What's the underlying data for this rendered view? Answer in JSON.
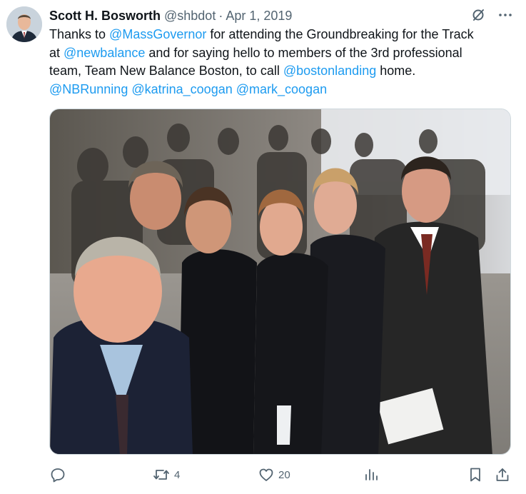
{
  "tweet": {
    "author_name": "Scott H. Bosworth",
    "author_handle": "@shbdot",
    "separator": "·",
    "date": "Apr 1, 2019",
    "text_lines": [
      [
        {
          "t": "Thanks to ",
          "m": false
        },
        {
          "t": "@MassGovernor",
          "m": true
        },
        {
          "t": " for attending the Groundbreaking for the Track",
          "m": false
        }
      ],
      [
        {
          "t": "at ",
          "m": false
        },
        {
          "t": "@newbalance",
          "m": true
        },
        {
          "t": " and for saying hello to members of the 3rd professional",
          "m": false
        }
      ],
      [
        {
          "t": "team, Team New Balance Boston, to call ",
          "m": false
        },
        {
          "t": "@bostonlanding",
          "m": true
        },
        {
          "t": " home.",
          "m": false
        }
      ],
      [
        {
          "t": "@NBRunning",
          "m": true
        },
        {
          "t": " ",
          "m": false
        },
        {
          "t": "@katrina_coogan",
          "m": true
        },
        {
          "t": " ",
          "m": false
        },
        {
          "t": "@mark_coogan",
          "m": true
        }
      ]
    ]
  },
  "actions": {
    "reply_count": "",
    "retweet_count": "4",
    "like_count": "20",
    "views_count": ""
  },
  "colors": {
    "accent": "#1d9bf0",
    "secondary_text": "#536471",
    "primary_text": "#0f1419"
  },
  "icons": [
    "grok-icon",
    "more-icon",
    "reply-icon",
    "retweet-icon",
    "like-icon",
    "views-icon",
    "bookmark-icon",
    "share-icon"
  ]
}
